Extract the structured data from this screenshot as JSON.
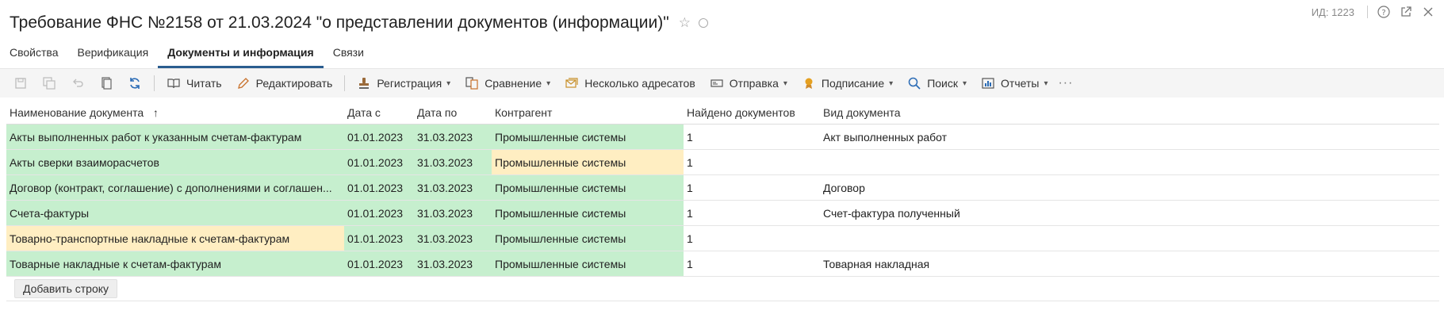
{
  "header": {
    "title": "Требование ФНС №2158 от 21.03.2024 \"о представлении документов (информации)\"",
    "id_label": "ИД: 1223"
  },
  "tabs": [
    {
      "label": "Свойства",
      "active": false
    },
    {
      "label": "Верификация",
      "active": false
    },
    {
      "label": "Документы и информация",
      "active": true
    },
    {
      "label": "Связи",
      "active": false
    }
  ],
  "toolbar": {
    "read": "Читать",
    "edit": "Редактировать",
    "registration": "Регистрация",
    "compare": "Сравнение",
    "multi_addressees": "Несколько адресатов",
    "send": "Отправка",
    "sign": "Подписание",
    "search": "Поиск",
    "reports": "Отчеты",
    "more": "···"
  },
  "table": {
    "columns": [
      "Наименование документа",
      "Дата с",
      "Дата по",
      "Контрагент",
      "Найдено документов",
      "Вид документа"
    ],
    "sort_indicator": "↑",
    "rows": [
      {
        "name": "Акты выполненных работ к указанным счетам-фактурам",
        "date_from": "01.01.2023",
        "date_to": "31.03.2023",
        "counterparty": "Промышленные системы",
        "found": "1",
        "doc_type": "Акт выполненных работ",
        "name_status": "green",
        "counterparty_status": "green"
      },
      {
        "name": "Акты сверки взаиморасчетов",
        "date_from": "01.01.2023",
        "date_to": "31.03.2023",
        "counterparty": "Промышленные системы",
        "found": "1",
        "doc_type": "",
        "name_status": "green",
        "counterparty_status": "yellow"
      },
      {
        "name": "Договор (контракт, соглашение) с дополнениями и соглашен...",
        "date_from": "01.01.2023",
        "date_to": "31.03.2023",
        "counterparty": "Промышленные системы",
        "found": "1",
        "doc_type": "Договор",
        "name_status": "green",
        "counterparty_status": "green"
      },
      {
        "name": "Счета-фактуры",
        "date_from": "01.01.2023",
        "date_to": "31.03.2023",
        "counterparty": "Промышленные системы",
        "found": "1",
        "doc_type": "Счет-фактура полученный",
        "name_status": "green",
        "counterparty_status": "green"
      },
      {
        "name": "Товарно-транспортные накладные к счетам-фактурам",
        "date_from": "01.01.2023",
        "date_to": "31.03.2023",
        "counterparty": "Промышленные системы",
        "found": "1",
        "doc_type": "",
        "name_status": "yellow",
        "counterparty_status": "green"
      },
      {
        "name": "Товарные накладные к счетам-фактурам",
        "date_from": "01.01.2023",
        "date_to": "31.03.2023",
        "counterparty": "Промышленные системы",
        "found": "1",
        "doc_type": "Товарная накладная",
        "name_status": "green",
        "counterparty_status": "green"
      }
    ]
  },
  "add_row_label": "Добавить строку",
  "colors": {
    "green": "#c6efce",
    "yellow": "#ffeec2",
    "accent": "#2a5d8f"
  }
}
